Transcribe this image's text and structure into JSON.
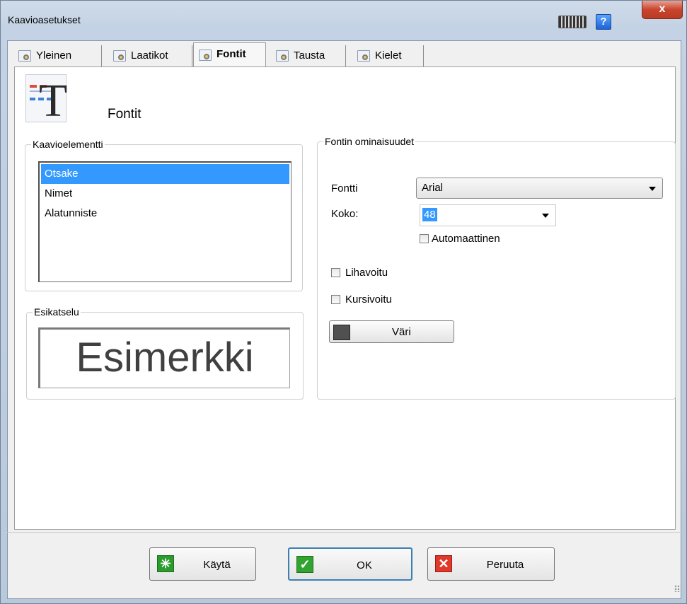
{
  "window": {
    "title": "Kaavioasetukset",
    "help_label": "?",
    "close_label": "x"
  },
  "tabs": [
    {
      "label": "Yleinen",
      "active": false
    },
    {
      "label": "Laatikot",
      "active": false
    },
    {
      "label": "Fontit",
      "active": true
    },
    {
      "label": "Tausta",
      "active": false
    },
    {
      "label": "Kielet",
      "active": false
    }
  ],
  "header": {
    "title": "Fontit"
  },
  "element_group": {
    "legend": "Kaavioelementti",
    "items": [
      {
        "label": "Otsake",
        "selected": true
      },
      {
        "label": "Nimet",
        "selected": false
      },
      {
        "label": "Alatunniste",
        "selected": false
      }
    ]
  },
  "preview_group": {
    "legend": "Esikatselu",
    "sample_text": "Esimerkki"
  },
  "font_group": {
    "legend": "Fontin ominaisuudet",
    "font_label": "Fontti",
    "font_value": "Arial",
    "size_label": "Koko:",
    "size_value": "48",
    "auto_label": "Automaattinen",
    "auto_checked": false,
    "bold_label": "Lihavoitu",
    "bold_checked": false,
    "italic_label": "Kursivoitu",
    "italic_checked": false,
    "color_label": "Väri",
    "color_value": "#505050"
  },
  "buttons": {
    "apply": "Käytä",
    "ok": "OK",
    "cancel": "Peruuta"
  }
}
